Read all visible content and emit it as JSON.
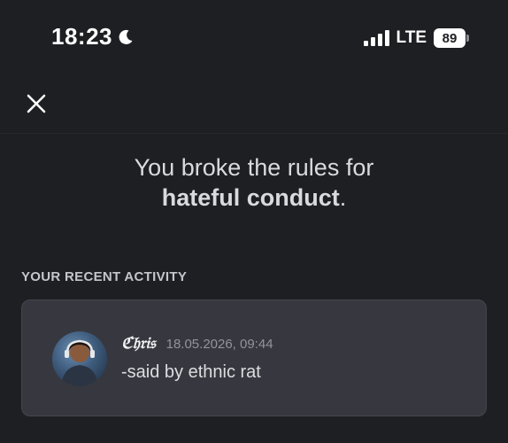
{
  "status_bar": {
    "time": "18:23",
    "network": "LTE",
    "battery": "89"
  },
  "icons": {
    "moon": "moon-icon",
    "signal": "signal-bars-icon",
    "battery": "battery-icon",
    "close": "close-icon",
    "avatar": "user-avatar"
  },
  "header": {
    "headline_line1": "You broke the rules for",
    "headline_emphasis": "hateful conduct",
    "headline_end": "."
  },
  "activity": {
    "section_label": "YOUR RECENT ACTIVITY",
    "author": "ℭ𝔥𝔯𝔦𝔰",
    "timestamp": "18.05.2026, 09:44",
    "message": "-said by ethnic rat"
  },
  "colors": {
    "background": "#1e1f23",
    "card": "#37383f",
    "text": "#d9dade",
    "muted": "#92949b"
  }
}
